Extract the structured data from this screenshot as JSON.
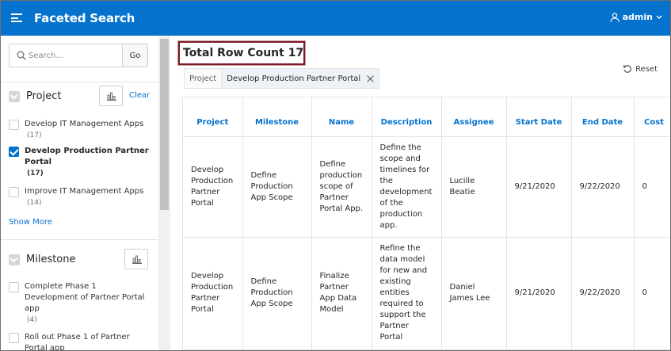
{
  "header": {
    "title": "Faceted Search",
    "user": "admin",
    "menu_icon": "hamburger-icon",
    "user_icon": "user-icon"
  },
  "search": {
    "placeholder": "Search...",
    "go_label": "Go"
  },
  "facets": [
    {
      "title": "Project",
      "clear_label": "Clear",
      "options": [
        {
          "label": "Develop IT Management Apps",
          "count": "(17)",
          "checked": false
        },
        {
          "label": "Develop Production Partner Portal",
          "count": "(17)",
          "checked": true
        },
        {
          "label": "Improve IT Management Apps",
          "count": "(14)",
          "checked": false
        }
      ],
      "show_more": "Show More"
    },
    {
      "title": "Milestone",
      "options": [
        {
          "label": "Complete Phase 1 Development of Partner Portal app",
          "count": "(4)",
          "checked": false
        },
        {
          "label": "Roll out Phase 1 of Partner Portal app",
          "count": "",
          "checked": false
        }
      ]
    }
  ],
  "main": {
    "row_count_label": "Total Row Count 17",
    "reset_label": "Reset",
    "filter_label": "Project",
    "filter_chip": "Develop Production Partner Portal"
  },
  "table": {
    "columns": [
      "Project",
      "Milestone",
      "Name",
      "Description",
      "Assignee",
      "Start Date",
      "End Date",
      "Cost"
    ],
    "rows": [
      [
        "Develop Production Partner Portal",
        "Define Production App Scope",
        "Define production scope of Partner Portal App.",
        "Define the scope and timelines for the development of the production app.",
        "Lucille Beatie",
        "9/21/2020",
        "9/22/2020",
        "0"
      ],
      [
        "Develop Production Partner Portal",
        "Define Production App Scope",
        "Finalize Partner App Data Model",
        "Refine the data model for new and existing entities required to support the Partner Portal",
        "Daniel James Lee",
        "9/21/2020",
        "9/22/2020",
        "0"
      ]
    ]
  },
  "colors": {
    "header_bg": "#0572ce",
    "link": "#0572ce",
    "highlight_border": "#7a1c25"
  }
}
